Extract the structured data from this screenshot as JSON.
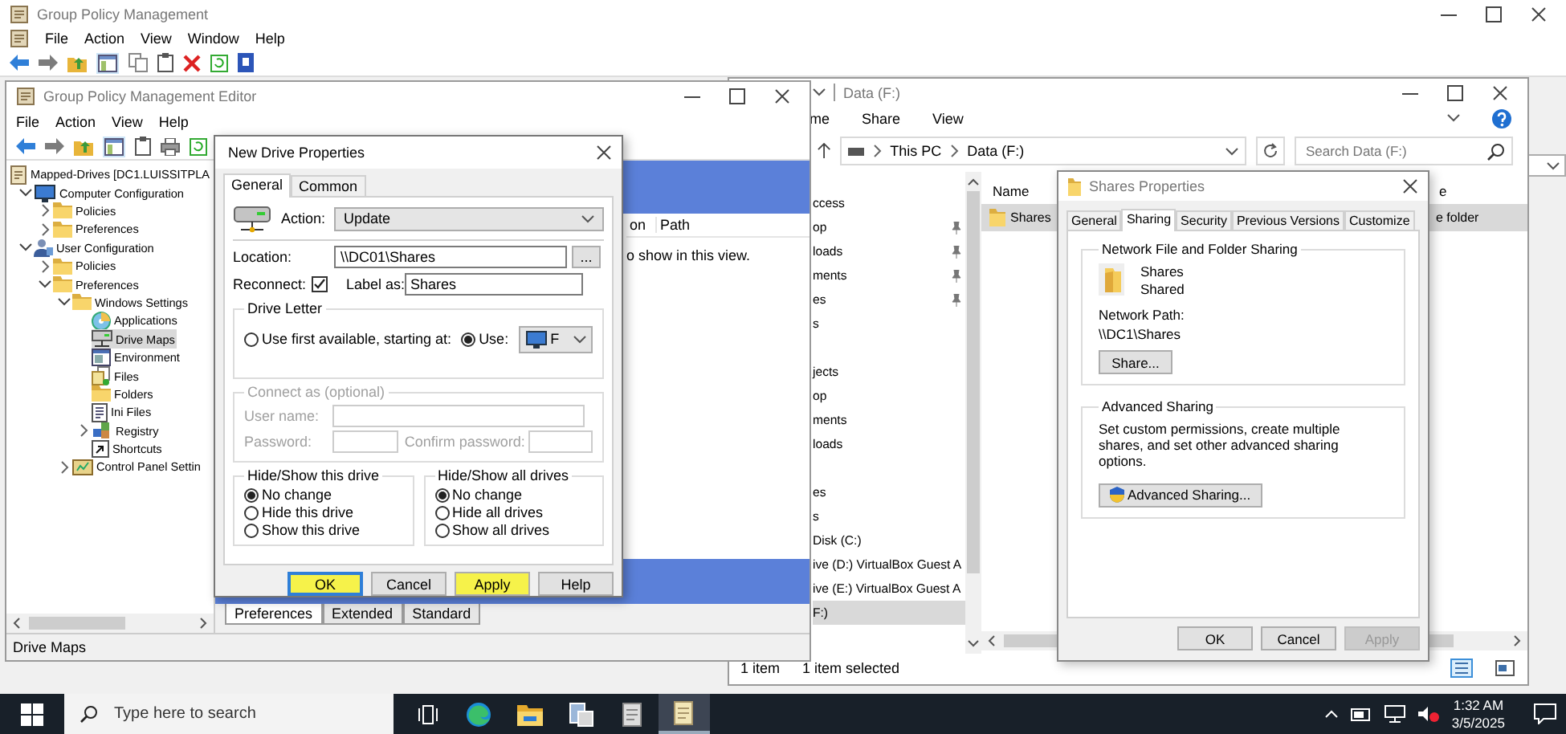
{
  "gpm_window": {
    "title": "Group Policy Management",
    "menu": [
      "File",
      "Action",
      "View",
      "Window",
      "Help"
    ]
  },
  "gpme_window": {
    "title": "Group Policy Management Editor",
    "menu": [
      "File",
      "Action",
      "View",
      "Help"
    ],
    "tree": [
      {
        "label": "Mapped-Drives [DC1.LUISSITPLA",
        "kind": "gpo",
        "selected": false,
        "children": [
          {
            "label": "Computer Configuration",
            "kind": "computer",
            "selected": false,
            "expanded": true,
            "children": [
              {
                "label": "Policies",
                "kind": "folder",
                "selected": false,
                "expanded": false
              },
              {
                "label": "Preferences",
                "kind": "folder",
                "selected": false,
                "expanded": false
              }
            ]
          },
          {
            "label": "User Configuration",
            "kind": "user",
            "selected": false,
            "expanded": true,
            "children": [
              {
                "label": "Policies",
                "kind": "folder",
                "selected": false,
                "expanded": false
              },
              {
                "label": "Preferences",
                "kind": "folder",
                "selected": false,
                "expanded": true,
                "children": [
                  {
                    "label": "Windows Settings",
                    "kind": "folder",
                    "selected": false,
                    "expanded": true,
                    "children": [
                      {
                        "label": "Applications",
                        "kind": "app",
                        "selected": false
                      },
                      {
                        "label": "Drive Maps",
                        "kind": "drive",
                        "selected": true
                      },
                      {
                        "label": "Environment",
                        "kind": "env",
                        "selected": false
                      },
                      {
                        "label": "Files",
                        "kind": "file",
                        "selected": false
                      },
                      {
                        "label": "Folders",
                        "kind": "folder",
                        "selected": false
                      },
                      {
                        "label": "Ini Files",
                        "kind": "ini",
                        "selected": false
                      },
                      {
                        "label": "Registry",
                        "kind": "registry",
                        "selected": false,
                        "expanded": false
                      },
                      {
                        "label": "Shortcuts",
                        "kind": "shortcut",
                        "selected": false
                      }
                    ]
                  },
                  {
                    "label": "Control Panel Settin",
                    "kind": "panel",
                    "selected": false,
                    "expanded": false
                  }
                ]
              }
            ]
          }
        ]
      }
    ],
    "columns": [
      "on",
      "Path"
    ],
    "empty_message": "o show in this view.",
    "tabs": [
      {
        "label": "Preferences",
        "selected": true
      },
      {
        "label": "Extended",
        "selected": false
      },
      {
        "label": "Standard",
        "selected": false
      }
    ],
    "status": "Drive Maps"
  },
  "explorer": {
    "title": "Data (F:)",
    "ribbon": [
      "me",
      "Share",
      "View"
    ],
    "path": [
      "This PC",
      "Data (F:)"
    ],
    "search": {
      "placeholder": "Search Data (F:)"
    },
    "nav_groups": [
      [
        {
          "label": "ccess",
          "pinned": false,
          "selected": false
        },
        {
          "label": "op",
          "pinned": true,
          "selected": false
        },
        {
          "label": "loads",
          "pinned": true,
          "selected": false
        },
        {
          "label": "ments",
          "pinned": true,
          "selected": false
        },
        {
          "label": "es",
          "pinned": true,
          "selected": false
        },
        {
          "label": "s",
          "pinned": false,
          "selected": false
        }
      ],
      [
        {
          "label": "jects",
          "pinned": false,
          "selected": false
        },
        {
          "label": "op",
          "pinned": false,
          "selected": false
        },
        {
          "label": "ments",
          "pinned": false,
          "selected": false
        },
        {
          "label": "loads",
          "pinned": false,
          "selected": false
        }
      ],
      [
        {
          "label": "es",
          "pinned": false,
          "selected": false
        },
        {
          "label": "s",
          "pinned": false,
          "selected": false
        },
        {
          "label": "Disk (C:)",
          "pinned": false,
          "selected": false
        },
        {
          "label": "ive (D:) VirtualBox Guest A",
          "pinned": false,
          "selected": false
        },
        {
          "label": "ive (E:) VirtualBox Guest A",
          "pinned": false,
          "selected": false
        },
        {
          "label": "F:)",
          "pinned": false,
          "selected": true
        }
      ]
    ],
    "columns": [
      "Name",
      "e"
    ],
    "rows": [
      {
        "name": "Shares",
        "type": "e folder",
        "selected": true
      }
    ],
    "status": [
      "1 item",
      "1 item selected"
    ]
  },
  "drive_dialog": {
    "title": "New Drive Properties",
    "tabs": [
      {
        "label": "General",
        "selected": true
      },
      {
        "label": "Common",
        "selected": false
      }
    ],
    "action": {
      "label": "Action:",
      "value": "Update"
    },
    "location": {
      "label": "Location:",
      "value": "\\\\DC01\\Shares",
      "browse": "..."
    },
    "reconnect": {
      "label": "Reconnect:",
      "checked": true
    },
    "label_as": {
      "label": "Label as:",
      "value": "Shares"
    },
    "drive_letter": {
      "title": "Drive Letter",
      "options": [
        {
          "label": "Use first available, starting at:",
          "selected": false
        },
        {
          "label": "Use:",
          "selected": true
        }
      ],
      "letter": "F"
    },
    "connect_as": {
      "title": "Connect as (optional)",
      "disabled": true,
      "user_label": "User name:",
      "password_label": "Password:",
      "confirm_label": "Confirm password:"
    },
    "hide_show": [
      {
        "title": "Hide/Show this drive",
        "options": [
          {
            "label": "No change",
            "selected": true
          },
          {
            "label": "Hide this drive",
            "selected": false
          },
          {
            "label": "Show this drive",
            "selected": false
          }
        ]
      },
      {
        "title": "Hide/Show all drives",
        "options": [
          {
            "label": "No change",
            "selected": true
          },
          {
            "label": "Hide all drives",
            "selected": false
          },
          {
            "label": "Show all drives",
            "selected": false
          }
        ]
      }
    ],
    "buttons": [
      {
        "label": "OK",
        "default": true,
        "highlighted": true
      },
      {
        "label": "Cancel",
        "default": false,
        "highlighted": false
      },
      {
        "label": "Apply",
        "default": false,
        "highlighted": true
      },
      {
        "label": "Help",
        "default": false,
        "highlighted": false
      }
    ]
  },
  "shares_props": {
    "title": "Shares Properties",
    "tabs": [
      {
        "label": "General",
        "selected": false
      },
      {
        "label": "Sharing",
        "selected": true
      },
      {
        "label": "Security",
        "selected": false
      },
      {
        "label": "Previous Versions",
        "selected": false
      },
      {
        "label": "Customize",
        "selected": false
      }
    ],
    "sharing": {
      "title": "Network File and Folder Sharing",
      "name": "Shares",
      "state": "Shared",
      "path_label": "Network Path:",
      "path": "\\\\DC1\\Shares",
      "button": "Share..."
    },
    "advanced": {
      "title": "Advanced Sharing",
      "text": "Set custom permissions, create multiple shares, and set other advanced sharing options.",
      "button": "Advanced Sharing..."
    },
    "buttons": [
      {
        "label": "OK",
        "disabled": false
      },
      {
        "label": "Cancel",
        "disabled": false
      },
      {
        "label": "Apply",
        "disabled": true
      }
    ]
  },
  "taskbar": {
    "search": {
      "placeholder": "Type here to search"
    },
    "apps": [
      {
        "kind": "taskview",
        "active": false
      },
      {
        "kind": "edge",
        "active": false
      },
      {
        "kind": "explorer",
        "active": false
      },
      {
        "kind": "server",
        "active": false
      },
      {
        "kind": "gpm",
        "active": false
      },
      {
        "kind": "gpme",
        "active": true
      }
    ],
    "time": "1:32 AM",
    "date": "3/5/2025"
  }
}
